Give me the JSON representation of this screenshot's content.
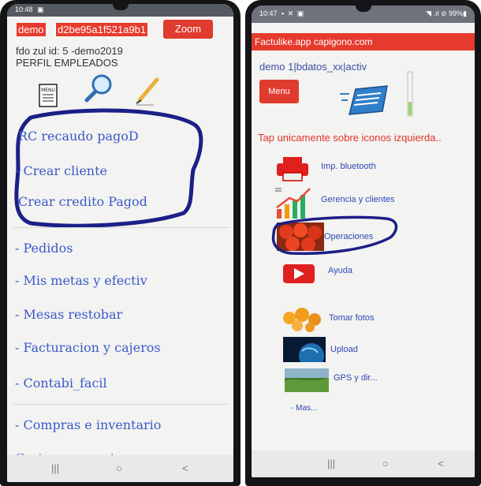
{
  "left_phone": {
    "status": {
      "time": "10:48",
      "icons": "▣"
    },
    "top": {
      "company": "demo",
      "session": "d2be95a1f521a9b1",
      "zoom_label": "Zoom"
    },
    "info_line_1": "fdo zul id: 5 -demo2019",
    "info_line_2": "PERFIL EMPLEADOS",
    "header_icons": [
      "menu-icon",
      "search-icon",
      "pencil-icon"
    ],
    "menu_icon_text": "MENU",
    "menu_items": [
      "RC recaudo pagoD",
      "- Crear cliente",
      "Crear credito Pagod",
      "- Pedidos",
      "- Mis metas y efectiv",
      "- Mesas restobar",
      "- Facturacion y cajeros",
      "- Contabi_facil",
      "- Compras e inventario",
      "Cartera y cuentas por pagar"
    ],
    "nav": [
      "|||",
      "○",
      "<"
    ]
  },
  "right_phone": {
    "status": {
      "time": "10:47",
      "icons": "▪ ✕ ▣",
      "right": "◥ .ıl ⊘ 99%▮"
    },
    "app_title": "Factulike.app capigono.com",
    "subline": "demo  1|bdatos_xx|activ",
    "menu_label": "Menu",
    "hint": "Tap unicamente sobre iconos izquierda..",
    "items": [
      {
        "label": "Imp. bluetooth",
        "icon": "printer-icon"
      },
      {
        "label": "Gerencia y clientes",
        "icon": "growth-chart-icon"
      },
      {
        "label": "Operaciones",
        "icon": "tomatoes-icon"
      },
      {
        "label": "Ayuda",
        "icon": "play-video-icon"
      },
      {
        "label": "Tomar fotos",
        "icon": "flowers-photo-icon"
      },
      {
        "label": "Upload",
        "icon": "globe-icon"
      },
      {
        "label": "GPS y dir...",
        "icon": "landscape-icon"
      }
    ],
    "more": "- Mas...",
    "nav": [
      "|||",
      "○",
      "<"
    ]
  },
  "colors": {
    "accent_red": "#e63a2e",
    "link_blue": "#3a59c9",
    "ink_blue": "#1c1f86"
  }
}
